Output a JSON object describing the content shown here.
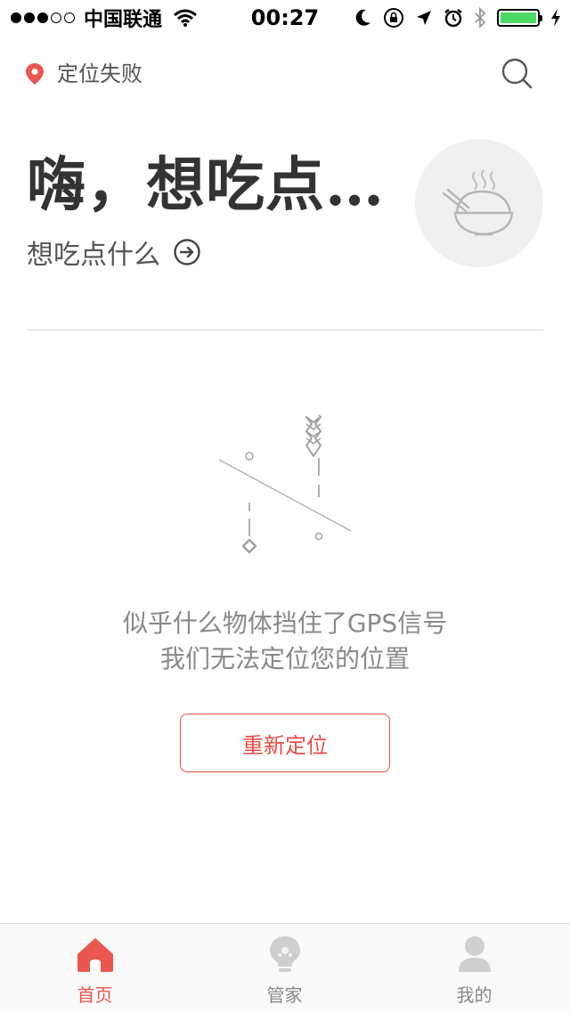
{
  "status_bar": {
    "carrier": "中国联通",
    "time": "00:27",
    "signal_strength": 3,
    "signal_max": 5,
    "battery_level": 1.0,
    "icons": [
      "wifi-icon",
      "moon-icon",
      "rotation-lock-icon",
      "location-arrow-icon",
      "alarm-icon",
      "bluetooth-icon",
      "battery-icon",
      "charging-icon"
    ]
  },
  "location": {
    "status_text": "定位失败",
    "icon": "location-pin-icon",
    "search_icon": "search-icon"
  },
  "hero": {
    "title": "嗨，想吃点…",
    "subtitle": "想吃点什么",
    "arrow_icon": "arrow-right-circle-icon",
    "image_icon": "rice-bowl-icon"
  },
  "empty_state": {
    "illustration": "broken-arrow-icon",
    "line1": "似乎什么物体挡住了GPS信号",
    "line2": "我们无法定位您的位置",
    "retry_label": "重新定位"
  },
  "tabs": [
    {
      "label": "首页",
      "icon": "home-icon",
      "active": true
    },
    {
      "label": "管家",
      "icon": "lightbulb-icon",
      "active": false
    },
    {
      "label": "我的",
      "icon": "user-icon",
      "active": false
    }
  ],
  "colors": {
    "accent": "#e9574f",
    "battery": "#4cd964",
    "text_primary": "#333333",
    "text_muted": "#8a8a8a"
  }
}
